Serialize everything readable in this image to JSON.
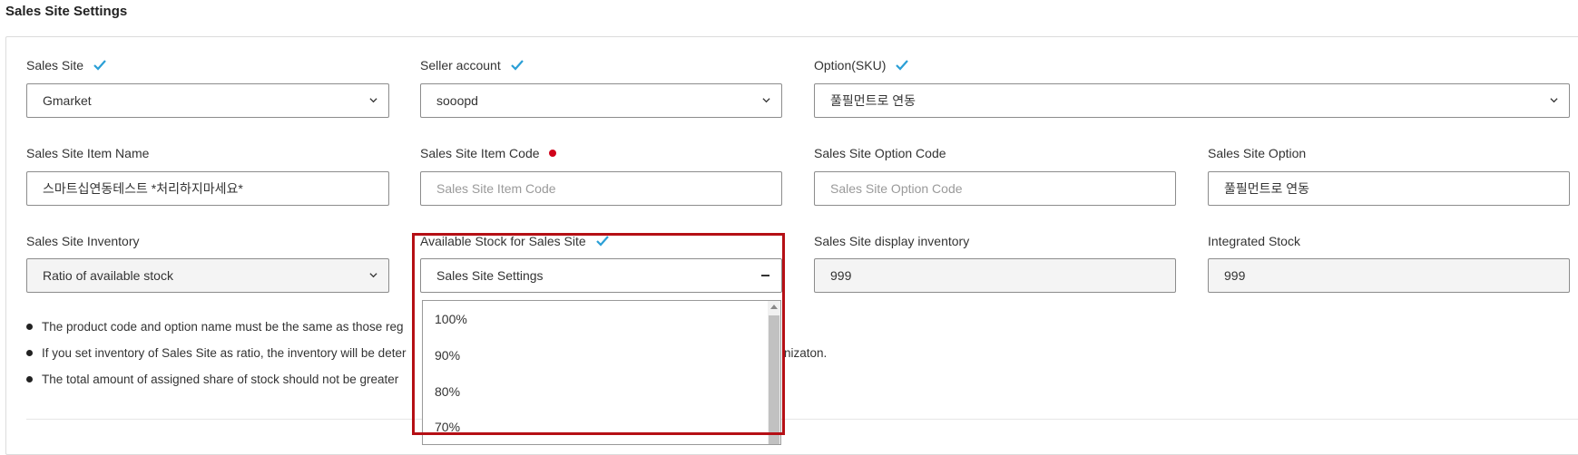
{
  "page_title": "Sales Site Settings",
  "fields": {
    "sales_site": {
      "label": "Sales Site",
      "value": "Gmarket"
    },
    "seller_account": {
      "label": "Seller account",
      "value": "sooopd"
    },
    "option_sku": {
      "label": "Option(SKU)",
      "value": "풀필먼트로 연동"
    },
    "item_name": {
      "label": "Sales Site Item Name",
      "value": "스마트십연동테스트 *처리하지마세요*"
    },
    "item_code": {
      "label": "Sales Site Item Code",
      "placeholder": "Sales Site Item Code"
    },
    "option_code": {
      "label": "Sales Site Option Code",
      "placeholder": "Sales Site Option Code"
    },
    "option": {
      "label": "Sales Site Option",
      "value": "풀필먼트로 연동"
    },
    "inventory": {
      "label": "Sales Site Inventory",
      "value": "Ratio of available stock"
    },
    "available_stock": {
      "label": "Available Stock for Sales Site",
      "value": "Sales Site Settings"
    },
    "display_inventory": {
      "label": "Sales Site display inventory",
      "value": "999"
    },
    "integrated_stock": {
      "label": "Integrated Stock",
      "value": "999"
    }
  },
  "dropdown_options": [
    "100%",
    "90%",
    "80%",
    "70%"
  ],
  "notes": [
    "The product code and option name must be the same as those reg",
    "If you set inventory of Sales Site as ratio, the inventory will be deter",
    "The total amount of assigned share of stock should not be greater"
  ],
  "notes_tail": "nizaton.",
  "colors": {
    "check": "#2a9fd6",
    "required_dot": "#d0021b",
    "highlight": "#b50f15"
  }
}
